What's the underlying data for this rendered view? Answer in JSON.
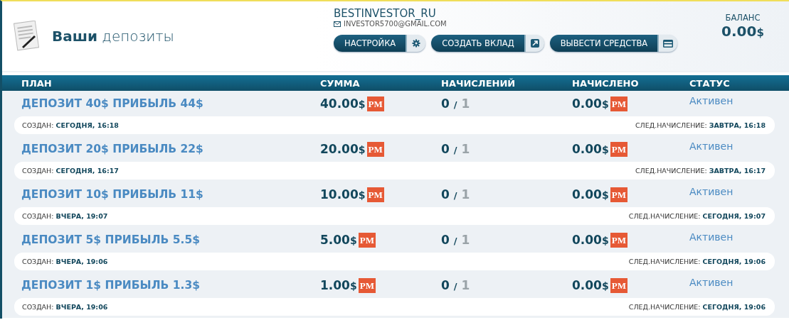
{
  "header": {
    "title": "**Ваши** депозиты",
    "username": "BESTINVESTOR_RU",
    "email": "INVESTOR5700@GMAIL.COM",
    "buttons": [
      {
        "label": "НАСТРОЙКА",
        "kind": "settings"
      },
      {
        "label": "СОЗДАТЬ ВКЛАД",
        "kind": "create"
      },
      {
        "label": "ВЫВЕСТИ СРЕДСТВА",
        "kind": "withdraw"
      }
    ],
    "balance_label": "БАЛАНС",
    "balance": "0.00",
    "balance_currency": "$"
  },
  "table": {
    "columns": [
      "ПЛАН",
      "СУММА",
      "НАЧИСЛЕНИЙ",
      "НАЧИСЛЕНО",
      "СТАТУС"
    ],
    "rows": [
      {
        "plan": "ДЕПОЗИТ 40$ ПРИБЫЛЬ 44$",
        "amount": "40.00",
        "amount_currency": "$",
        "amount_badge": "PM",
        "done": "0",
        "separator": "/",
        "total": "1",
        "accrued": "0.00",
        "accrued_currency": "$",
        "accrued_badge": "PM",
        "status": "Активен",
        "created_label": "СОЗДАН:",
        "created": "СЕГОДНЯ, 16:18",
        "next_label": "СЛЕД.НАЧИСЛЕНИЕ:",
        "next": "ЗАВТРА, 16:18"
      },
      {
        "plan": "ДЕПОЗИТ 20$ ПРИБЫЛЬ 22$",
        "amount": "20.00",
        "amount_currency": "$",
        "amount_badge": "PM",
        "done": "0",
        "separator": "/",
        "total": "1",
        "accrued": "0.00",
        "accrued_currency": "$",
        "accrued_badge": "PM",
        "status": "Активен",
        "created_label": "СОЗДАН:",
        "created": "СЕГОДНЯ, 16:17",
        "next_label": "СЛЕД.НАЧИСЛЕНИЕ:",
        "next": "ЗАВТРА, 16:17"
      },
      {
        "plan": "ДЕПОЗИТ 10$ ПРИБЫЛЬ 11$",
        "amount": "10.00",
        "amount_currency": "$",
        "amount_badge": "PM",
        "done": "0",
        "separator": "/",
        "total": "1",
        "accrued": "0.00",
        "accrued_currency": "$",
        "accrued_badge": "PM",
        "status": "Активен",
        "created_label": "СОЗДАН:",
        "created": "ВЧЕРА, 19:07",
        "next_label": "СЛЕД.НАЧИСЛЕНИЕ:",
        "next": "СЕГОДНЯ, 19:07"
      },
      {
        "plan": "ДЕПОЗИТ 5$ ПРИБЫЛЬ 5.5$",
        "amount": "5.00",
        "amount_currency": "$",
        "amount_badge": "PM",
        "done": "0",
        "separator": "/",
        "total": "1",
        "accrued": "0.00",
        "accrued_currency": "$",
        "accrued_badge": "PM",
        "status": "Активен",
        "created_label": "СОЗДАН:",
        "created": "ВЧЕРА, 19:06",
        "next_label": "СЛЕД.НАЧИСЛЕНИЕ:",
        "next": "СЕГОДНЯ, 19:06"
      },
      {
        "plan": "ДЕПОЗИТ 1$ ПРИБЫЛЬ 1.3$",
        "amount": "1.00",
        "amount_currency": "$",
        "amount_badge": "PM",
        "done": "0",
        "separator": "/",
        "total": "1",
        "accrued": "0.00",
        "accrued_currency": "$",
        "accrued_badge": "PM",
        "status": "Активен",
        "created_label": "СОЗДАН:",
        "created": "ВЧЕРА, 19:06",
        "next_label": "СЛЕД.НАЧИСЛЕНИЕ:",
        "next": "СЕГОДНЯ, 19:06"
      }
    ]
  }
}
